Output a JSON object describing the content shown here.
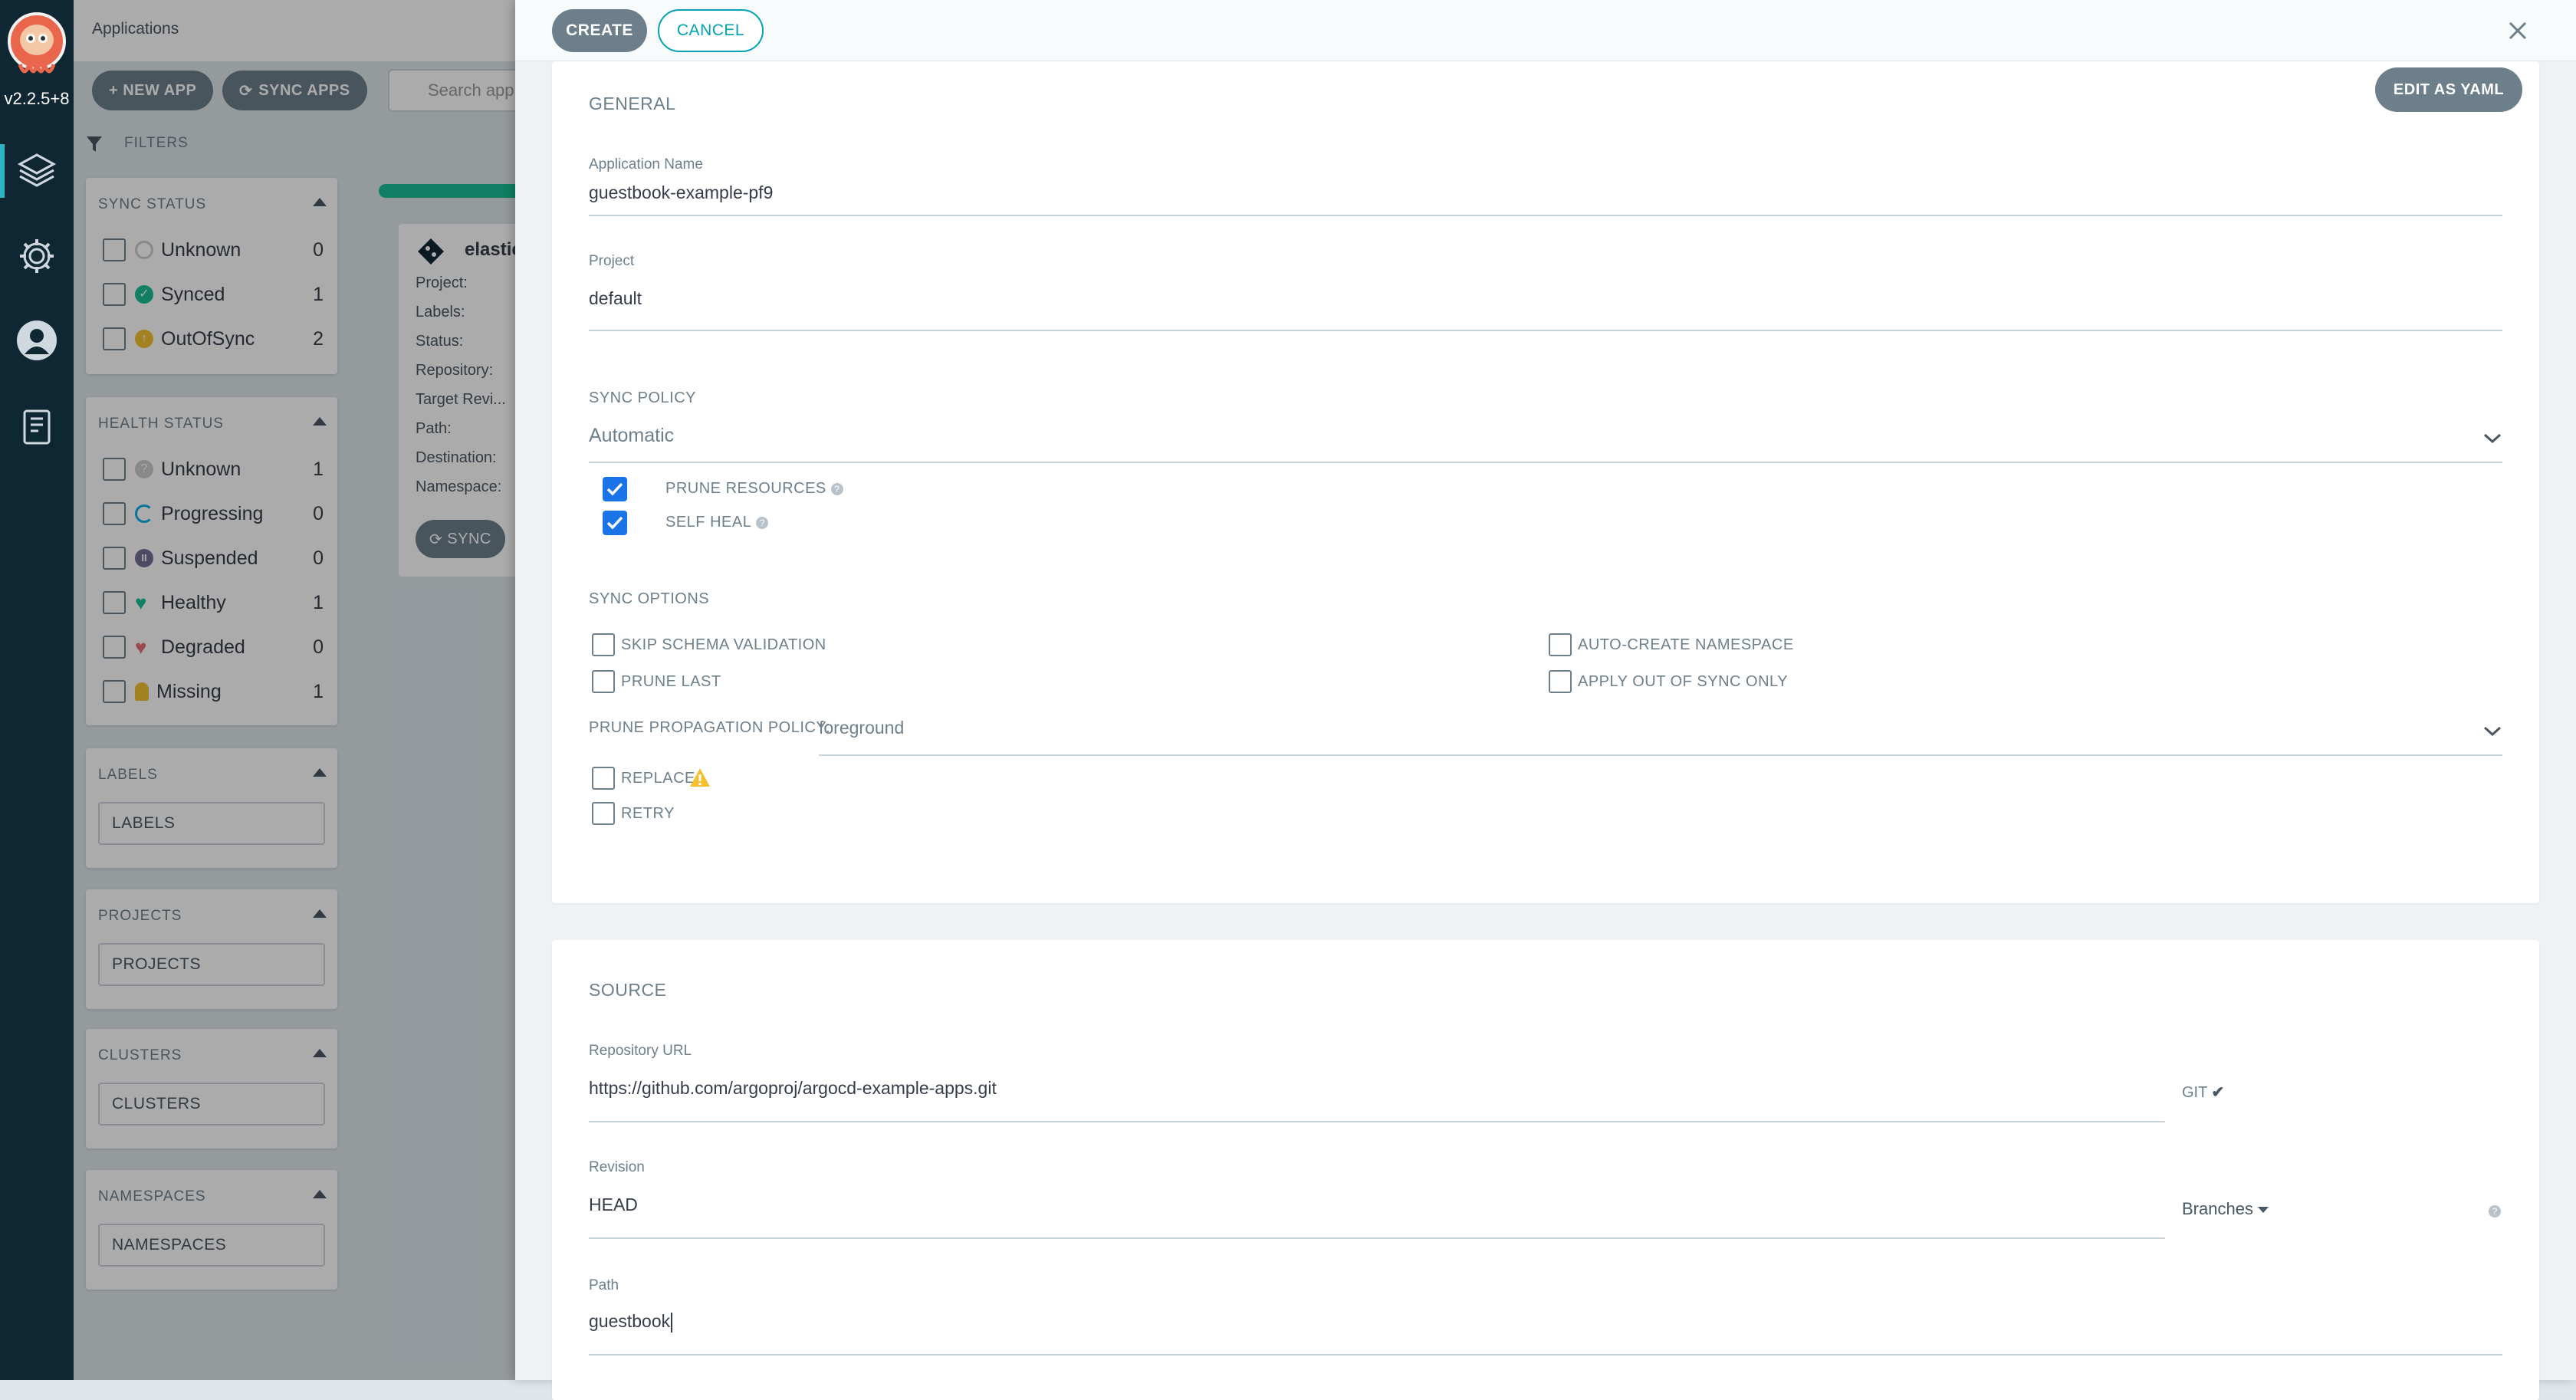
{
  "nav": {
    "version": "v2.2.5+8",
    "items": [
      {
        "icon": "applications-icon",
        "active": true
      },
      {
        "icon": "gear-icon"
      },
      {
        "icon": "user-icon"
      },
      {
        "icon": "docs-icon"
      }
    ]
  },
  "apps_page": {
    "title": "Applications",
    "new_app": "+ NEW APP",
    "sync_apps": "SYNC APPS",
    "search_placeholder": "Search app",
    "filters_label": "FILTERS",
    "sync_status": {
      "title": "SYNC STATUS",
      "items": [
        {
          "label": "Unknown",
          "count": "0",
          "icon": "unknown-circle-icon",
          "color": "#cccccc"
        },
        {
          "label": "Synced",
          "count": "1",
          "icon": "check-circle-icon",
          "color": "#18be94"
        },
        {
          "label": "OutOfSync",
          "count": "2",
          "icon": "arrow-up-circle-icon",
          "color": "#f4c030"
        }
      ]
    },
    "health_status": {
      "title": "HEALTH STATUS",
      "items": [
        {
          "label": "Unknown",
          "count": "1",
          "icon": "question-circle-icon",
          "color": "#cccccc"
        },
        {
          "label": "Progressing",
          "count": "0",
          "icon": "spinner-icon",
          "color": "#0dadea"
        },
        {
          "label": "Suspended",
          "count": "0",
          "icon": "pause-circle-icon",
          "color": "#766f94"
        },
        {
          "label": "Healthy",
          "count": "1",
          "icon": "heart-icon",
          "color": "#18be94"
        },
        {
          "label": "Degraded",
          "count": "0",
          "icon": "broken-heart-icon",
          "color": "#e96d76"
        },
        {
          "label": "Missing",
          "count": "1",
          "icon": "ghost-icon",
          "color": "#f4c030"
        }
      ]
    },
    "labels": {
      "title": "LABELS",
      "placeholder": "LABELS"
    },
    "projects": {
      "title": "PROJECTS",
      "placeholder": "PROJECTS"
    },
    "clusters": {
      "title": "CLUSTERS",
      "placeholder": "CLUSTERS"
    },
    "namespaces": {
      "title": "NAMESPACES",
      "placeholder": "NAMESPACES"
    },
    "card": {
      "name": "elastic",
      "fields": [
        "Project:",
        "Labels:",
        "Status:",
        "Repository:",
        "Target Revi...",
        "Path:",
        "Destination:",
        "Namespace:"
      ],
      "sync_button": "SYNC"
    }
  },
  "panel": {
    "create": "CREATE",
    "cancel": "CANCEL",
    "edit_yaml": "EDIT AS YAML",
    "general": {
      "title": "GENERAL",
      "app_name_label": "Application Name",
      "app_name": "guestbook-example-pf9",
      "project_label": "Project",
      "project": "default"
    },
    "sync_policy": {
      "title": "SYNC POLICY",
      "value": "Automatic",
      "prune_resources": "PRUNE RESOURCES",
      "self_heal": "SELF HEAL"
    },
    "sync_options": {
      "title": "SYNC OPTIONS",
      "skip_schema": "SKIP SCHEMA VALIDATION",
      "auto_create_ns": "AUTO-CREATE NAMESPACE",
      "prune_last": "PRUNE LAST",
      "apply_out_of_sync": "APPLY OUT OF SYNC ONLY",
      "prune_propagation_label": "PRUNE PROPAGATION POLICY:",
      "prune_propagation_value": "foreground",
      "replace": "REPLACE",
      "retry": "RETRY"
    },
    "source": {
      "title": "SOURCE",
      "repo_label": "Repository URL",
      "repo_url": "https://github.com/argoproj/argocd-example-apps.git",
      "repo_type": "GIT",
      "revision_label": "Revision",
      "revision": "HEAD",
      "revision_type": "Branches",
      "path_label": "Path",
      "path": "guestbook"
    }
  }
}
